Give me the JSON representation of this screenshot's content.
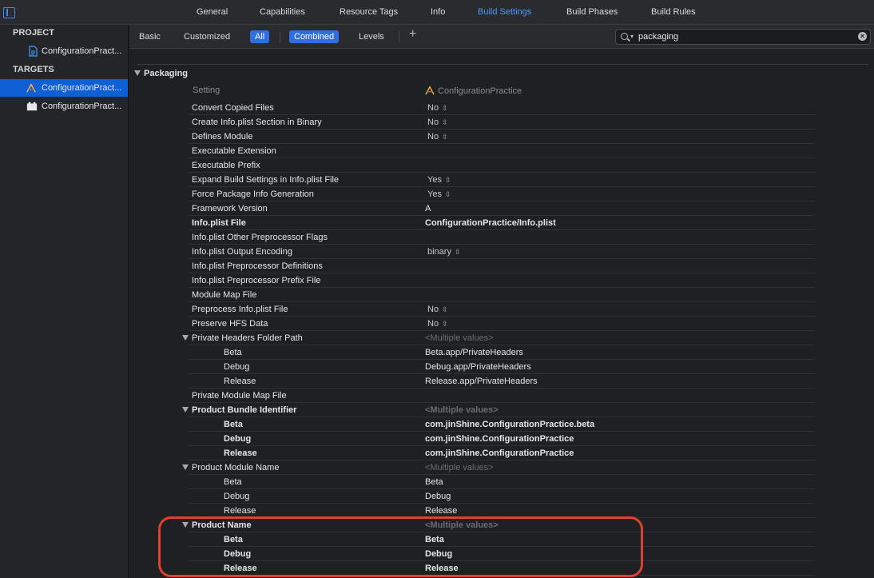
{
  "tabs": [
    "General",
    "Capabilities",
    "Resource Tags",
    "Info",
    "Build Settings",
    "Build Phases",
    "Build Rules"
  ],
  "active_tab": "Build Settings",
  "sidebar": {
    "project_header": "PROJECT",
    "project_item": "ConfigurationPract...",
    "targets_header": "TARGETS",
    "target_items": [
      "ConfigurationPract...",
      "ConfigurationPract..."
    ]
  },
  "filter": {
    "basic": "Basic",
    "customized": "Customized",
    "all": "All",
    "combined": "Combined",
    "levels": "Levels",
    "plus": "+",
    "search_value": "packaging"
  },
  "section": {
    "title": "Packaging",
    "col_setting": "Setting",
    "col_target": "ConfigurationPractice"
  },
  "rows": [
    {
      "name": "Convert Copied Files",
      "value": "No"
    },
    {
      "name": "Create Info.plist Section in Binary",
      "value": "No"
    },
    {
      "name": "Defines Module",
      "value": "No"
    },
    {
      "name": "Executable Extension",
      "value": ""
    },
    {
      "name": "Executable Prefix",
      "value": ""
    },
    {
      "name": "Expand Build Settings in Info.plist File",
      "value": "Yes"
    },
    {
      "name": "Force Package Info Generation",
      "value": "Yes"
    },
    {
      "name": "Framework Version",
      "value": "A"
    },
    {
      "name": "Info.plist File",
      "value": "ConfigurationPractice/Info.plist"
    },
    {
      "name": "Info.plist Other Preprocessor Flags",
      "value": ""
    },
    {
      "name": "Info.plist Output Encoding",
      "value": "binary"
    },
    {
      "name": "Info.plist Preprocessor Definitions",
      "value": ""
    },
    {
      "name": "Info.plist Preprocessor Prefix File",
      "value": ""
    },
    {
      "name": "Module Map File",
      "value": ""
    },
    {
      "name": "Preprocess Info.plist File",
      "value": "No"
    },
    {
      "name": "Preserve HFS Data",
      "value": "No"
    },
    {
      "name": "Private Headers Folder Path",
      "value": "<Multiple values>"
    },
    {
      "name": "Beta",
      "value": "Beta.app/PrivateHeaders"
    },
    {
      "name": "Debug",
      "value": "Debug.app/PrivateHeaders"
    },
    {
      "name": "Release",
      "value": "Release.app/PrivateHeaders"
    },
    {
      "name": "Private Module Map File",
      "value": ""
    },
    {
      "name": "Product Bundle Identifier",
      "value": "<Multiple values>"
    },
    {
      "name": "Beta",
      "value": "com.jinShine.ConfigurationPractice.beta"
    },
    {
      "name": "Debug",
      "value": "com.jinShine.ConfigurationPractice"
    },
    {
      "name": "Release",
      "value": "com.jinShine.ConfigurationPractice"
    },
    {
      "name": "Product Module Name",
      "value": "<Multiple values>"
    },
    {
      "name": "Beta",
      "value": "Beta"
    },
    {
      "name": "Debug",
      "value": "Debug"
    },
    {
      "name": "Release",
      "value": "Release"
    },
    {
      "name": "Product Name",
      "value": "<Multiple values>"
    },
    {
      "name": "Beta",
      "value": "Beta"
    },
    {
      "name": "Debug",
      "value": "Debug"
    },
    {
      "name": "Release",
      "value": "Release"
    }
  ],
  "colors": {
    "accent": "#4a9bff",
    "selection": "#0f5fd6",
    "highlight": "#e0412f"
  }
}
